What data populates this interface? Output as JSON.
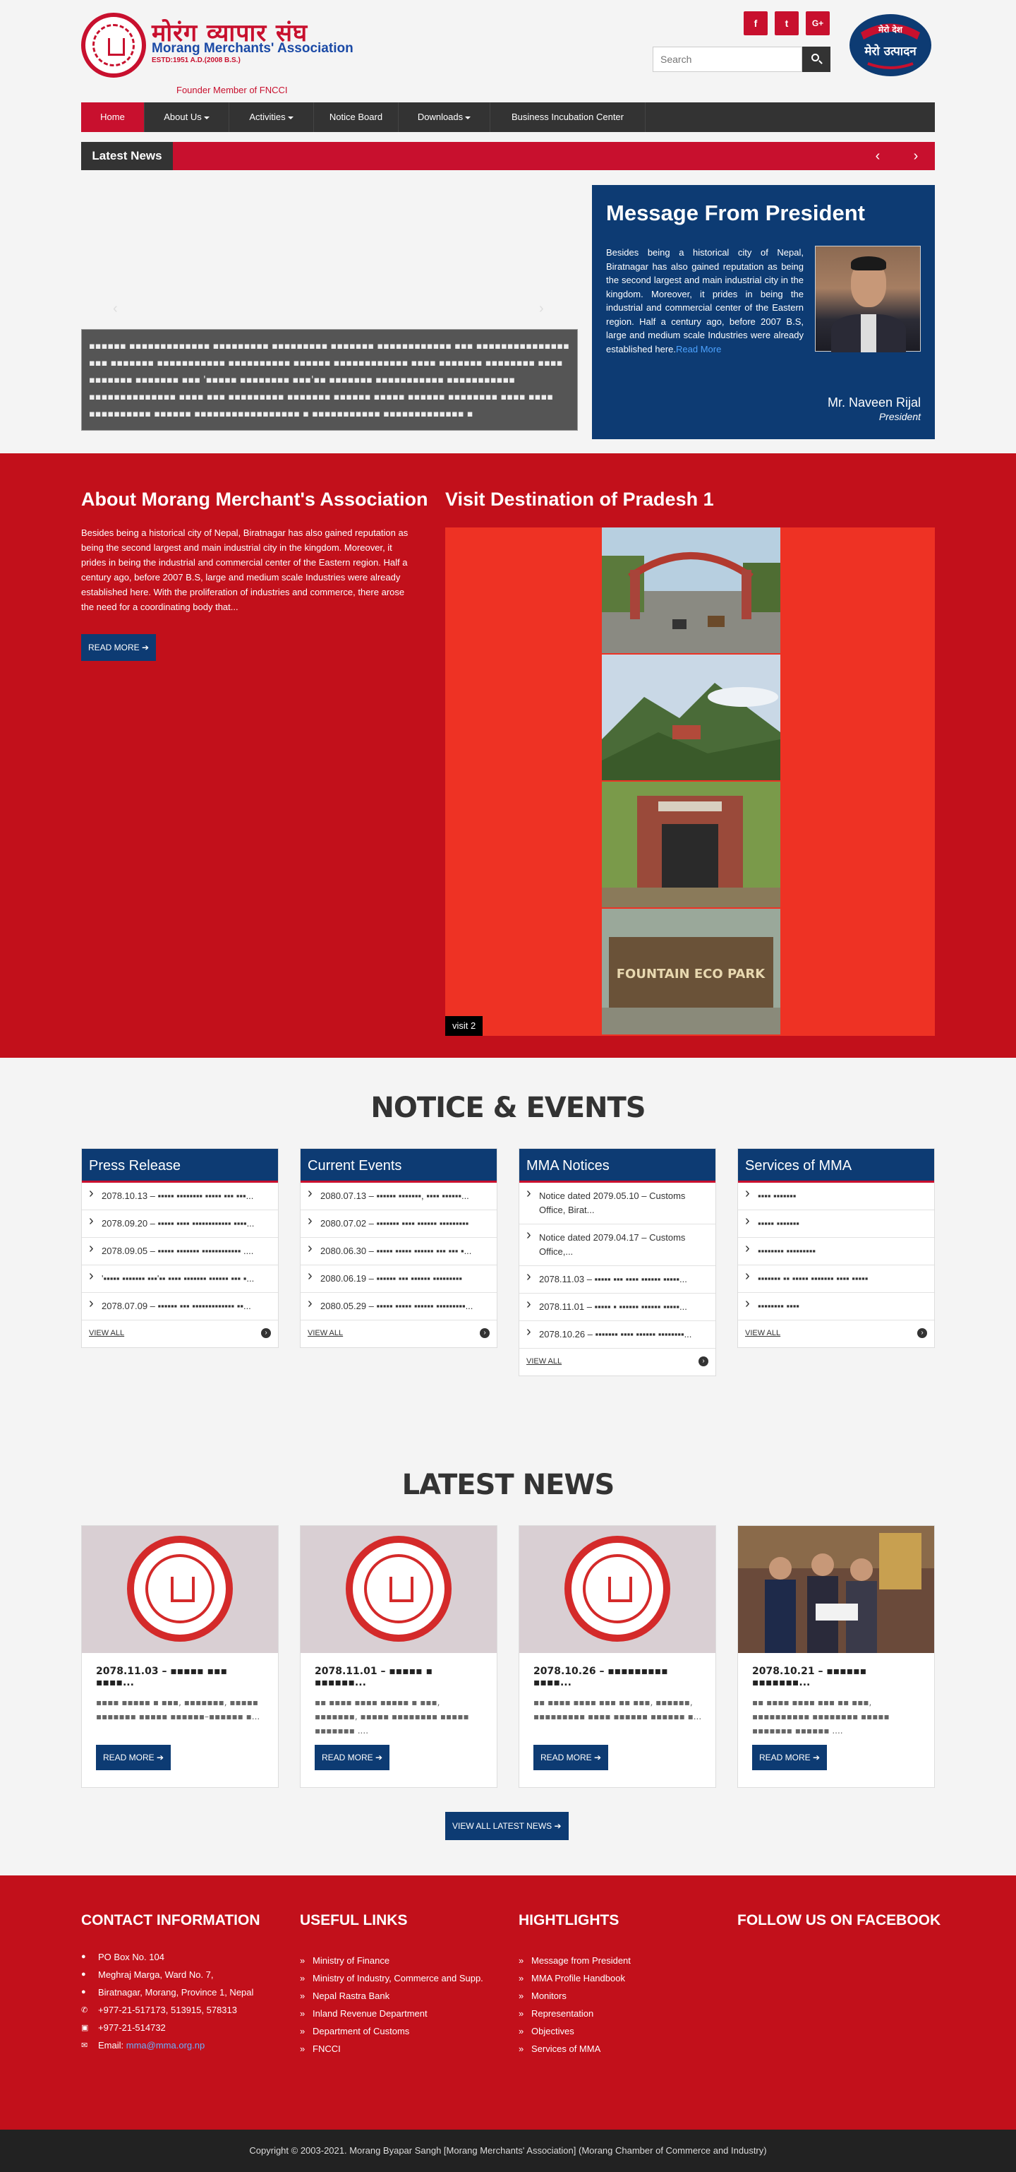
{
  "header": {
    "logo_np": "मोरंग व्यापार संघ",
    "logo_en": "Morang Merchants' Association",
    "logo_estd": "ESTD:1951 A.D.(2008 B.S.)",
    "fncci": "Founder Member of FNCCI",
    "social": [
      "f",
      "t",
      "G+"
    ],
    "search_placeholder": "Search",
    "badge_top": "मेरो देश",
    "badge_main": "मेरो उत्पादन"
  },
  "nav": {
    "items": [
      "Home",
      "About Us",
      "Activities",
      "Notice Board",
      "Downloads",
      "Business Incubation Center"
    ]
  },
  "ticker": {
    "label": "Latest News",
    "prev": "‹",
    "next": "›"
  },
  "slider": {
    "caption": "▪▪▪▪▪▪ ▪▪▪▪▪▪▪▪▪▪▪▪▪ ▪▪▪▪▪▪▪▪▪ ▪▪▪▪▪▪▪▪▪ ▪▪▪▪▪▪▪ ▪▪▪▪▪▪▪▪▪▪▪▪ ▪▪▪ ▪▪▪▪▪▪▪▪▪▪▪▪▪▪▪ ▪▪▪ ▪▪▪▪▪▪▪ ▪▪▪▪▪▪▪▪▪▪▪ ▪▪▪▪▪▪▪▪▪▪ ▪▪▪▪▪▪ ▪▪▪▪▪▪▪▪▪▪▪▪ ▪▪▪▪ ▪▪▪▪▪▪▪ ▪▪▪▪▪▪▪▪ ▪▪▪▪ ▪▪▪▪▪▪▪ ▪▪▪▪▪▪▪ ▪▪▪ '▪▪▪▪▪ ▪▪▪▪▪▪▪▪ ▪▪▪'▪▪ ▪▪▪▪▪▪▪ ▪▪▪▪▪▪▪▪▪▪▪ ▪▪▪▪▪▪▪▪▪▪▪ ▪▪▪▪▪▪▪▪▪▪▪▪▪▪ ▪▪▪▪ ▪▪▪ ▪▪▪▪▪▪▪▪▪ ▪▪▪▪▪▪▪ ▪▪▪▪▪▪ ▪▪▪▪▪ ▪▪▪▪▪▪ ▪▪▪▪▪▪▪▪ ▪▪▪▪ ▪▪▪▪ ▪▪▪▪▪▪▪▪▪▪ ▪▪▪▪▪▪ ▪▪▪▪▪▪▪▪▪▪▪▪▪▪▪▪▪ ▪ ▪▪▪▪▪▪▪▪▪▪▪ ▪▪▪▪▪▪▪▪▪▪▪▪▪ ▪"
  },
  "president": {
    "title": "Message From President",
    "text": "Besides being a historical city of Nepal, Biratnagar has also gained reputation as being the second largest and main industrial city in the kingdom. Moreover, it prides in being the industrial and commercial center of the Eastern region. Half a century ago, before 2007 B.S, large and medium scale Industries were already established here.",
    "read_more": "Read More",
    "name": "Mr. Naveen Rijal",
    "role": "President"
  },
  "about": {
    "title": "About Morang Merchant's Association",
    "text": "Besides being a historical city of Nepal, Biratnagar has also gained reputation as being the second largest and main industrial city in the kingdom. Moreover, it prides in being the industrial and commercial center of the Eastern region. Half a century ago, before 2007 B.S, large and medium scale Industries were already established here. With the proliferation of industries and commerce, there arose the need for a coordinating body that...",
    "button": "READ MORE"
  },
  "visit": {
    "title": "Visit Destination of Pradesh 1",
    "caption": "visit 2",
    "image_text": "FOUNTAIN ECO PARK"
  },
  "notice": {
    "heading": "NOTICE & EVENTS",
    "view_all": "VIEW ALL",
    "cards": [
      {
        "title": "Press Release",
        "items": [
          "2078.10.13 – ▪▪▪▪▪ ▪▪▪▪▪▪▪▪ ▪▪▪▪▪ ▪▪▪ ▪▪▪...",
          "2078.09.20 – ▪▪▪▪▪ ▪▪▪▪ ▪▪▪▪▪▪▪▪▪▪▪▪ ▪▪▪▪...",
          "2078.09.05 – ▪▪▪▪▪ ▪▪▪▪▪▪▪ ▪▪▪▪▪▪▪▪▪▪▪▪ ....",
          "'▪▪▪▪▪ ▪▪▪▪▪▪▪ ▪▪▪'▪▪ ▪▪▪▪ ▪▪▪▪▪▪▪ ▪▪▪▪▪▪ ▪▪▪ ▪...",
          "2078.07.09 – ▪▪▪▪▪▪ ▪▪▪ ▪▪▪▪▪▪▪▪▪▪▪▪▪ ▪▪..."
        ]
      },
      {
        "title": "Current Events",
        "items": [
          "2080.07.13 – ▪▪▪▪▪▪ ▪▪▪▪▪▪▪, ▪▪▪▪ ▪▪▪▪▪▪...",
          "2080.07.02 – ▪▪▪▪▪▪▪ ▪▪▪▪ ▪▪▪▪▪▪ ▪▪▪▪▪▪▪▪▪",
          "2080.06.30 – ▪▪▪▪▪ ▪▪▪▪▪ ▪▪▪▪▪▪ ▪▪▪ ▪▪▪ ▪...",
          "2080.06.19 – ▪▪▪▪▪▪ ▪▪▪ ▪▪▪▪▪▪ ▪▪▪▪▪▪▪▪▪",
          "2080.05.29 – ▪▪▪▪▪ ▪▪▪▪▪ ▪▪▪▪▪▪ ▪▪▪▪▪▪▪▪▪..."
        ]
      },
      {
        "title": "MMA Notices",
        "items": [
          "Notice dated 2079.05.10 – Customs Office, Birat...",
          "Notice dated 2079.04.17 – Customs Office,...",
          "2078.11.03 – ▪▪▪▪▪ ▪▪▪ ▪▪▪▪ ▪▪▪▪▪▪ ▪▪▪▪▪...",
          "2078.11.01 – ▪▪▪▪▪ ▪ ▪▪▪▪▪▪ ▪▪▪▪▪▪ ▪▪▪▪▪...",
          "2078.10.26 – ▪▪▪▪▪▪▪ ▪▪▪▪ ▪▪▪▪▪▪ ▪▪▪▪▪▪▪▪..."
        ]
      },
      {
        "title": "Services of MMA",
        "items": [
          "▪▪▪▪ ▪▪▪▪▪▪▪",
          "▪▪▪▪▪ ▪▪▪▪▪▪▪",
          "▪▪▪▪▪▪▪▪ ▪▪▪▪▪▪▪▪▪",
          "▪▪▪▪▪▪▪ ▪▪ ▪▪▪▪▪ ▪▪▪▪▪▪▪ ▪▪▪▪ ▪▪▪▪▪",
          "▪▪▪▪▪▪▪▪ ▪▪▪▪"
        ]
      }
    ]
  },
  "latest": {
    "heading": "LATEST NEWS",
    "button": "READ MORE",
    "view_all": "VIEW ALL LATEST NEWS",
    "cards": [
      {
        "title": "2078.11.03 – ▪▪▪▪▪ ▪▪▪ ▪▪▪▪...",
        "excerpt": "▪▪▪▪ ▪▪▪▪▪ ▪ ▪▪▪, ▪▪▪▪▪▪▪, ▪▪▪▪▪ ▪▪▪▪▪▪▪ ▪▪▪▪▪ ▪▪▪▪▪▪–▪▪▪▪▪▪ ▪..."
      },
      {
        "title": "2078.11.01 – ▪▪▪▪▪ ▪ ▪▪▪▪▪▪...",
        "excerpt": "▪▪ ▪▪▪▪ ▪▪▪▪ ▪▪▪▪▪ ▪ ▪▪▪, ▪▪▪▪▪▪▪, ▪▪▪▪▪ ▪▪▪▪▪▪▪▪ ▪▪▪▪▪ ▪▪▪▪▪▪▪ ...."
      },
      {
        "title": "2078.10.26 – ▪▪▪▪▪▪▪▪▪ ▪▪▪▪...",
        "excerpt": "▪▪ ▪▪▪▪ ▪▪▪▪ ▪▪▪ ▪▪ ▪▪▪, ▪▪▪▪▪▪, ▪▪▪▪▪▪▪▪▪ ▪▪▪▪ ▪▪▪▪▪▪ ▪▪▪▪▪▪ ▪..."
      },
      {
        "title": "2078.10.21 – ▪▪▪▪▪▪ ▪▪▪▪▪▪▪...",
        "excerpt": "▪▪ ▪▪▪▪ ▪▪▪▪ ▪▪▪ ▪▪ ▪▪▪, ▪▪▪▪▪▪▪▪▪▪ ▪▪▪▪▪▪▪▪ ▪▪▪▪▪ ▪▪▪▪▪▪▪ ▪▪▪▪▪▪ ...."
      }
    ]
  },
  "footer": {
    "contact_title": "CONTACT INFORMATION",
    "contact": [
      {
        "icon": "map-pin-icon",
        "text": "PO Box No. 104"
      },
      {
        "icon": "map-pin-icon",
        "text": "Meghraj Marga, Ward No. 7,"
      },
      {
        "icon": "map-pin-icon",
        "text": "Biratnagar, Morang, Province 1, Nepal"
      },
      {
        "icon": "phone-icon",
        "text": "+977-21-517173, 513915, 578313"
      },
      {
        "icon": "fax-icon",
        "text": "+977-21-514732"
      }
    ],
    "email_label": "Email:",
    "email": "mma@mma.org.np",
    "links_title": "USEFUL LINKS",
    "links": [
      "Ministry of Finance",
      "Ministry of Industry, Commerce and Supp.",
      "Nepal Rastra Bank",
      "Inland Revenue Department",
      "Department of Customs",
      "FNCCI"
    ],
    "highlights_title": "HIGHTLIGHTS",
    "highlights": [
      "Message from President",
      "MMA Profile Handbook",
      "Monitors",
      "Representation",
      "Objectives",
      "Services of MMA"
    ],
    "facebook_title": "FOLLOW US ON FACEBOOK"
  },
  "copyright": "Copyright © 2003-2021. Morang Byapar Sangh [Morang Merchants' Association] (Morang Chamber of Commerce and Industry)",
  "colors": {
    "brand_red": "#c8102e",
    "navy": "#0d3b73",
    "nav_dark": "#333333",
    "visit_bg": "#ee3224"
  }
}
